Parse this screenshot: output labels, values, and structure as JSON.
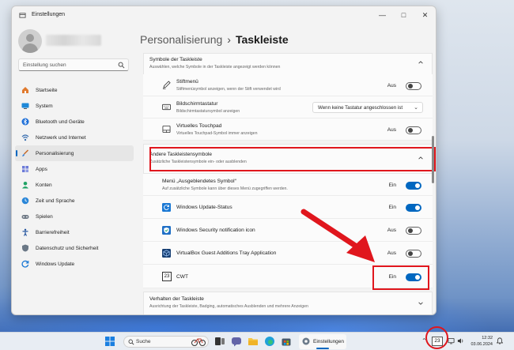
{
  "window": {
    "title": "Einstellungen"
  },
  "sidebar": {
    "search_placeholder": "Einstellung suchen",
    "items": [
      {
        "label": "Startseite"
      },
      {
        "label": "System"
      },
      {
        "label": "Bluetooth und Geräte"
      },
      {
        "label": "Netzwerk und Internet"
      },
      {
        "label": "Personalisierung",
        "active": true
      },
      {
        "label": "Apps"
      },
      {
        "label": "Konten"
      },
      {
        "label": "Zeit und Sprache"
      },
      {
        "label": "Spielen"
      },
      {
        "label": "Barrierefreiheit"
      },
      {
        "label": "Datenschutz und Sicherheit"
      },
      {
        "label": "Windows Update"
      }
    ]
  },
  "breadcrumb": {
    "parent": "Personalisierung",
    "separator": "›",
    "current": "Taskleiste"
  },
  "section_symbols": {
    "title": "Symbole der Taskleiste",
    "subtitle": "Auswählen, welche Symbole in der Taskleiste angezeigt werden können",
    "rows": [
      {
        "title": "Stiftmenü",
        "subtitle": "Stiftmenüsymbol anzeigen, wenn der Stift verwendet wird",
        "state": "Aus",
        "on": false
      },
      {
        "title": "Bildschirmtastatur",
        "subtitle": "Bildschirmtastatursymbol anzeigen",
        "dropdown": "Wenn keine Tastatur angeschlossen ist"
      },
      {
        "title": "Virtuelles Touchpad",
        "subtitle": "Virtuelles Touchpad-Symbol immer anzeigen",
        "state": "Aus",
        "on": false
      }
    ]
  },
  "section_other": {
    "title": "Andere Taskleistensymbole",
    "subtitle": "Zusätzliche Taskleistensymbole ein- oder ausblenden",
    "rows": [
      {
        "title": "Menü „Ausgeblendetes Symbol“",
        "subtitle": "Auf zusätzliche Symbole kann über dieses Menü zugegriffen werden.",
        "state": "Ein",
        "on": true
      },
      {
        "title": "Windows Update-Status",
        "state": "Ein",
        "on": true
      },
      {
        "title": "Windows Security notification icon",
        "state": "Aus",
        "on": false
      },
      {
        "title": "VirtualBox Guest Additions Tray Application",
        "state": "Aus",
        "on": false
      },
      {
        "title": "CWT",
        "icon_text": "23",
        "state": "Ein",
        "on": true
      }
    ]
  },
  "section_behavior": {
    "title": "Verhalten der Taskleiste",
    "subtitle": "Ausrichtung der Taskleiste, Badging, automatisches Ausblenden und mehrere Anzeigen"
  },
  "taskbar": {
    "search": "Suche",
    "active_app": "Einstellungen",
    "tray_badge": "23",
    "time": "12:32",
    "date": "03.06.2024"
  },
  "colors": {
    "accent": "#0067c0",
    "highlight": "#e0161d"
  }
}
